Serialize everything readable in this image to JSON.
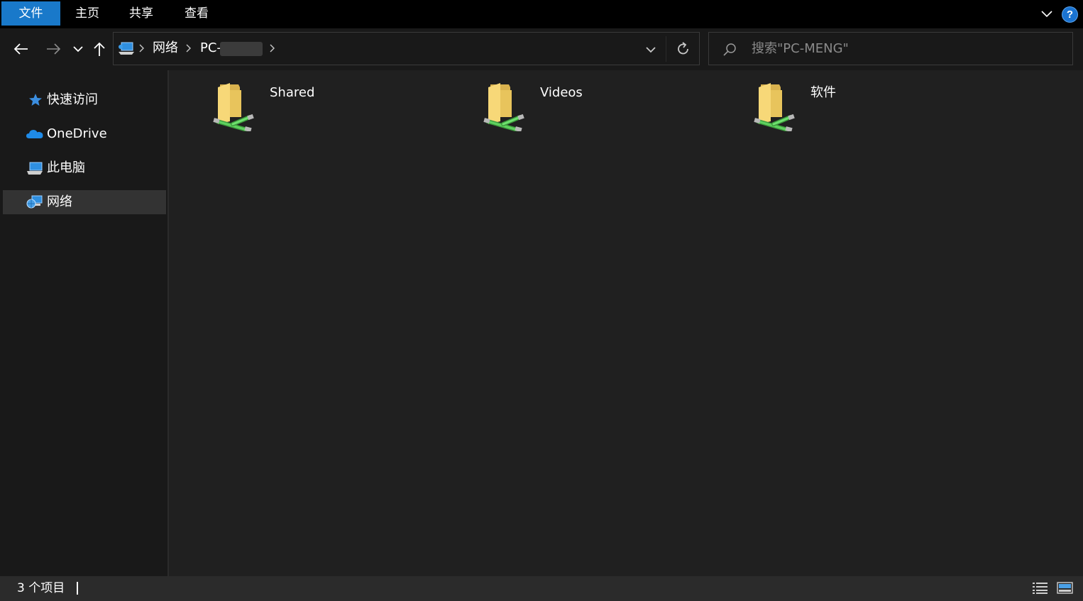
{
  "ribbon": {
    "tabs": [
      {
        "label": "文件",
        "active": true
      },
      {
        "label": "主页"
      },
      {
        "label": "共享"
      },
      {
        "label": "查看"
      }
    ],
    "accent_color": "#1979ca",
    "help_label": "?"
  },
  "address": {
    "crumbs": [
      {
        "label": "网络"
      },
      {
        "label": "PC-"
      }
    ],
    "icon": "network-computer-icon"
  },
  "search": {
    "placeholder": "搜索\"PC-MENG\""
  },
  "sidebar": {
    "items": [
      {
        "label": "快速访问",
        "icon": "star-icon"
      },
      {
        "label": "OneDrive",
        "icon": "cloud-icon"
      },
      {
        "label": "此电脑",
        "icon": "computer-icon"
      },
      {
        "label": "网络",
        "icon": "network-icon",
        "selected": true
      }
    ]
  },
  "content": {
    "items": [
      {
        "label": "Shared",
        "icon": "shared-folder-icon"
      },
      {
        "label": "Videos",
        "icon": "shared-folder-icon"
      },
      {
        "label": "软件",
        "icon": "shared-folder-icon"
      }
    ]
  },
  "status": {
    "item_count": "3 个项目"
  }
}
